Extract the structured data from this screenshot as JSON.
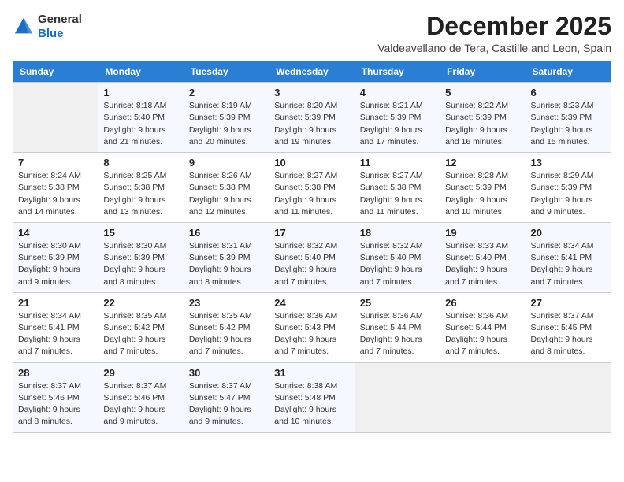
{
  "logo": {
    "general": "General",
    "blue": "Blue"
  },
  "header": {
    "month": "December 2025",
    "location": "Valdeavellano de Tera, Castille and Leon, Spain"
  },
  "weekdays": [
    "Sunday",
    "Monday",
    "Tuesday",
    "Wednesday",
    "Thursday",
    "Friday",
    "Saturday"
  ],
  "weeks": [
    [
      {
        "day": "",
        "empty": true
      },
      {
        "day": "1",
        "sunrise": "Sunrise: 8:18 AM",
        "sunset": "Sunset: 5:40 PM",
        "daylight": "Daylight: 9 hours and 21 minutes."
      },
      {
        "day": "2",
        "sunrise": "Sunrise: 8:19 AM",
        "sunset": "Sunset: 5:39 PM",
        "daylight": "Daylight: 9 hours and 20 minutes."
      },
      {
        "day": "3",
        "sunrise": "Sunrise: 8:20 AM",
        "sunset": "Sunset: 5:39 PM",
        "daylight": "Daylight: 9 hours and 19 minutes."
      },
      {
        "day": "4",
        "sunrise": "Sunrise: 8:21 AM",
        "sunset": "Sunset: 5:39 PM",
        "daylight": "Daylight: 9 hours and 17 minutes."
      },
      {
        "day": "5",
        "sunrise": "Sunrise: 8:22 AM",
        "sunset": "Sunset: 5:39 PM",
        "daylight": "Daylight: 9 hours and 16 minutes."
      },
      {
        "day": "6",
        "sunrise": "Sunrise: 8:23 AM",
        "sunset": "Sunset: 5:39 PM",
        "daylight": "Daylight: 9 hours and 15 minutes."
      }
    ],
    [
      {
        "day": "7",
        "sunrise": "Sunrise: 8:24 AM",
        "sunset": "Sunset: 5:38 PM",
        "daylight": "Daylight: 9 hours and 14 minutes."
      },
      {
        "day": "8",
        "sunrise": "Sunrise: 8:25 AM",
        "sunset": "Sunset: 5:38 PM",
        "daylight": "Daylight: 9 hours and 13 minutes."
      },
      {
        "day": "9",
        "sunrise": "Sunrise: 8:26 AM",
        "sunset": "Sunset: 5:38 PM",
        "daylight": "Daylight: 9 hours and 12 minutes."
      },
      {
        "day": "10",
        "sunrise": "Sunrise: 8:27 AM",
        "sunset": "Sunset: 5:38 PM",
        "daylight": "Daylight: 9 hours and 11 minutes."
      },
      {
        "day": "11",
        "sunrise": "Sunrise: 8:27 AM",
        "sunset": "Sunset: 5:38 PM",
        "daylight": "Daylight: 9 hours and 11 minutes."
      },
      {
        "day": "12",
        "sunrise": "Sunrise: 8:28 AM",
        "sunset": "Sunset: 5:39 PM",
        "daylight": "Daylight: 9 hours and 10 minutes."
      },
      {
        "day": "13",
        "sunrise": "Sunrise: 8:29 AM",
        "sunset": "Sunset: 5:39 PM",
        "daylight": "Daylight: 9 hours and 9 minutes."
      }
    ],
    [
      {
        "day": "14",
        "sunrise": "Sunrise: 8:30 AM",
        "sunset": "Sunset: 5:39 PM",
        "daylight": "Daylight: 9 hours and 9 minutes."
      },
      {
        "day": "15",
        "sunrise": "Sunrise: 8:30 AM",
        "sunset": "Sunset: 5:39 PM",
        "daylight": "Daylight: 9 hours and 8 minutes."
      },
      {
        "day": "16",
        "sunrise": "Sunrise: 8:31 AM",
        "sunset": "Sunset: 5:39 PM",
        "daylight": "Daylight: 9 hours and 8 minutes."
      },
      {
        "day": "17",
        "sunrise": "Sunrise: 8:32 AM",
        "sunset": "Sunset: 5:40 PM",
        "daylight": "Daylight: 9 hours and 7 minutes."
      },
      {
        "day": "18",
        "sunrise": "Sunrise: 8:32 AM",
        "sunset": "Sunset: 5:40 PM",
        "daylight": "Daylight: 9 hours and 7 minutes."
      },
      {
        "day": "19",
        "sunrise": "Sunrise: 8:33 AM",
        "sunset": "Sunset: 5:40 PM",
        "daylight": "Daylight: 9 hours and 7 minutes."
      },
      {
        "day": "20",
        "sunrise": "Sunrise: 8:34 AM",
        "sunset": "Sunset: 5:41 PM",
        "daylight": "Daylight: 9 hours and 7 minutes."
      }
    ],
    [
      {
        "day": "21",
        "sunrise": "Sunrise: 8:34 AM",
        "sunset": "Sunset: 5:41 PM",
        "daylight": "Daylight: 9 hours and 7 minutes."
      },
      {
        "day": "22",
        "sunrise": "Sunrise: 8:35 AM",
        "sunset": "Sunset: 5:42 PM",
        "daylight": "Daylight: 9 hours and 7 minutes."
      },
      {
        "day": "23",
        "sunrise": "Sunrise: 8:35 AM",
        "sunset": "Sunset: 5:42 PM",
        "daylight": "Daylight: 9 hours and 7 minutes."
      },
      {
        "day": "24",
        "sunrise": "Sunrise: 8:36 AM",
        "sunset": "Sunset: 5:43 PM",
        "daylight": "Daylight: 9 hours and 7 minutes."
      },
      {
        "day": "25",
        "sunrise": "Sunrise: 8:36 AM",
        "sunset": "Sunset: 5:44 PM",
        "daylight": "Daylight: 9 hours and 7 minutes."
      },
      {
        "day": "26",
        "sunrise": "Sunrise: 8:36 AM",
        "sunset": "Sunset: 5:44 PM",
        "daylight": "Daylight: 9 hours and 7 minutes."
      },
      {
        "day": "27",
        "sunrise": "Sunrise: 8:37 AM",
        "sunset": "Sunset: 5:45 PM",
        "daylight": "Daylight: 9 hours and 8 minutes."
      }
    ],
    [
      {
        "day": "28",
        "sunrise": "Sunrise: 8:37 AM",
        "sunset": "Sunset: 5:46 PM",
        "daylight": "Daylight: 9 hours and 8 minutes."
      },
      {
        "day": "29",
        "sunrise": "Sunrise: 8:37 AM",
        "sunset": "Sunset: 5:46 PM",
        "daylight": "Daylight: 9 hours and 9 minutes."
      },
      {
        "day": "30",
        "sunrise": "Sunrise: 8:37 AM",
        "sunset": "Sunset: 5:47 PM",
        "daylight": "Daylight: 9 hours and 9 minutes."
      },
      {
        "day": "31",
        "sunrise": "Sunrise: 8:38 AM",
        "sunset": "Sunset: 5:48 PM",
        "daylight": "Daylight: 9 hours and 10 minutes."
      },
      {
        "day": "",
        "empty": true
      },
      {
        "day": "",
        "empty": true
      },
      {
        "day": "",
        "empty": true
      }
    ]
  ]
}
